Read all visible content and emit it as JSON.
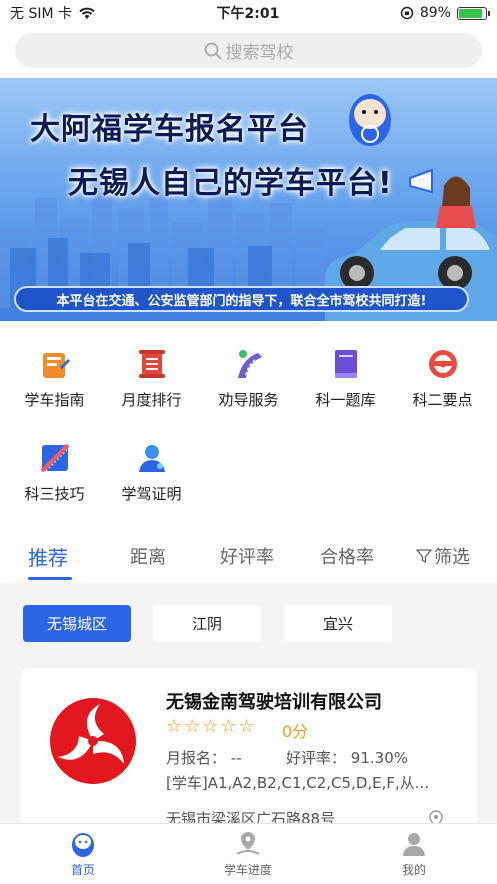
{
  "status_bar": {
    "carrier": "无 SIM 卡",
    "time": "下午2:01",
    "battery": "89%",
    "battery_level": 0.89
  },
  "search": {
    "placeholder": "搜索驾校"
  },
  "banner": {
    "title_line1": "大阿福学车报名平台",
    "title_line2": "无锡人自己的学车平台!",
    "footer": "本平台在交通、公安监管部门的指导下，联合全市驾校共同打造!"
  },
  "quick_menu": [
    {
      "label": "学车指南",
      "icon": "book-guide-icon"
    },
    {
      "label": "月度排行",
      "icon": "scroll-ranking-icon"
    },
    {
      "label": "劝导服务",
      "icon": "road-service-icon"
    },
    {
      "label": "科一题库",
      "icon": "question-bank-icon"
    },
    {
      "label": "科二要点",
      "icon": "steering-wheel-icon"
    },
    {
      "label": "科三技巧",
      "icon": "road-tips-icon"
    },
    {
      "label": "学驾证明",
      "icon": "learner-certificate-icon"
    }
  ],
  "tabs": [
    "推荐",
    "距离",
    "好评率",
    "合格率",
    "筛选"
  ],
  "regions": [
    "无锡城区",
    "江阴",
    "宜兴"
  ],
  "school": {
    "name": "无锡金南驾驶培训有限公司",
    "stars": "☆☆☆☆☆",
    "score": "0分",
    "monthly_label": "月报名：",
    "monthly_value": "--",
    "rating_label": "好评率：",
    "rating_value": "91.30%",
    "classes_tag": "[学车]",
    "classes": "A1,A2,B2,C1,C2,C5,D,E,F,从...",
    "address": "无锡市梁溪区广石路88号"
  },
  "bottom_nav": [
    {
      "label": "首页",
      "icon": "home-mascot-icon"
    },
    {
      "label": "学车进度",
      "icon": "progress-location-icon"
    },
    {
      "label": "我的",
      "icon": "user-profile-icon"
    }
  ],
  "colors": {
    "accent": "#2c66e6",
    "star": "#f39c12",
    "banner_dark": "#0b1c55"
  }
}
